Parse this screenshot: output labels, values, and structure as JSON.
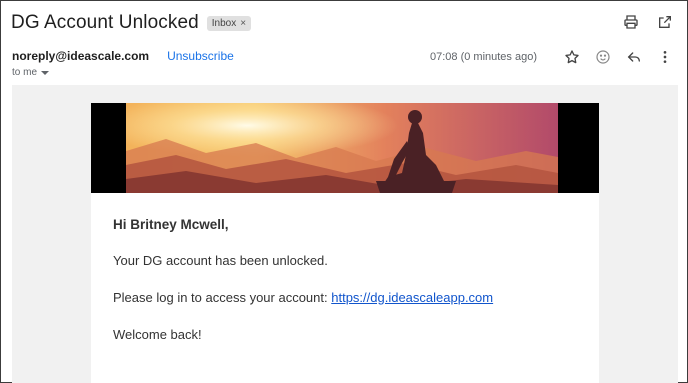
{
  "email": {
    "subject": "DG Account Unlocked",
    "label": "Inbox",
    "label_remove": "×",
    "sender": "noreply@ideascale.com",
    "unsubscribe": "Unsubscribe",
    "recipient": "to me",
    "timestamp": "07:08 (0 minutes ago)"
  },
  "icons": {
    "print": "print-icon",
    "popout": "open-in-new-window-icon",
    "star": "star-icon",
    "emoji": "emoji-reaction-icon",
    "reply": "reply-icon",
    "more": "more-vertical-icon"
  },
  "body": {
    "greeting": "Hi Britney Mcwell,",
    "line1": "Your DG account has been unlocked.",
    "line2_prefix": "Please log in to access your account: ",
    "line2_link": "https://dg.ideascaleapp.com",
    "line3": "Welcome back!"
  },
  "colors": {
    "link": "#1155cc",
    "unsubscribe": "#1a73e8",
    "content_bg": "#f1f1f1"
  }
}
